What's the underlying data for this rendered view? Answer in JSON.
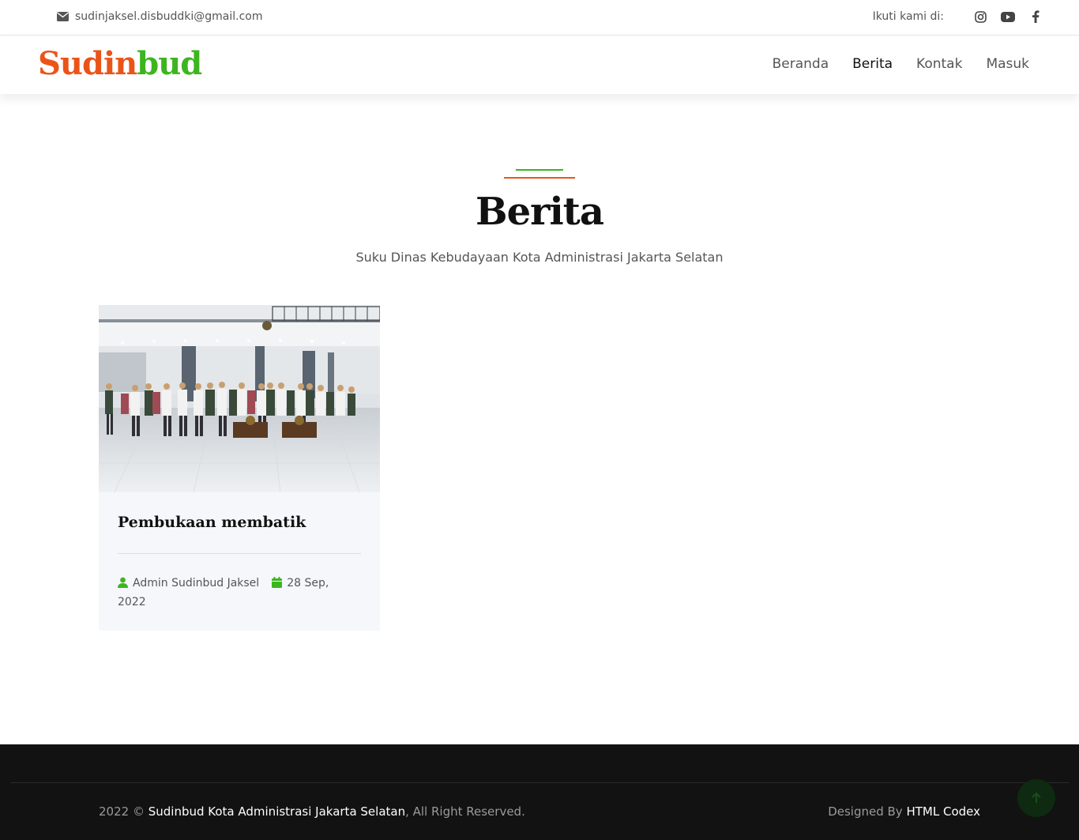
{
  "topbar": {
    "email": "sudinjaksel.disbuddki@gmail.com",
    "follow_label": "Ikuti kami di:",
    "social_icons": [
      "instagram-icon",
      "youtube-icon",
      "facebook-icon"
    ]
  },
  "brand": {
    "part1": "Sudin",
    "part2": "bud",
    "color1": "#ea5419",
    "color2": "#3db51f"
  },
  "nav": {
    "items": [
      {
        "label": "Beranda",
        "active": false
      },
      {
        "label": "Berita",
        "active": true
      },
      {
        "label": "Kontak",
        "active": false
      },
      {
        "label": "Masuk",
        "active": false
      }
    ]
  },
  "header": {
    "title": "Berita",
    "subtitle": "Suku Dinas Kebudayaan Kota Administrasi Jakarta Selatan"
  },
  "posts": [
    {
      "title": "Pembukaan membatik",
      "author": "Admin Sudinbud Jaksel",
      "date": "28 Sep, 2022",
      "image_icon": "photo-group-standing"
    }
  ],
  "footer": {
    "year": "2022 ©",
    "org": "Sudinbud Kota Administrasi Jakarta Selatan",
    "rights": ", All Right Reserved.",
    "designed_by": "Designed By",
    "designer": "HTML Codex"
  }
}
